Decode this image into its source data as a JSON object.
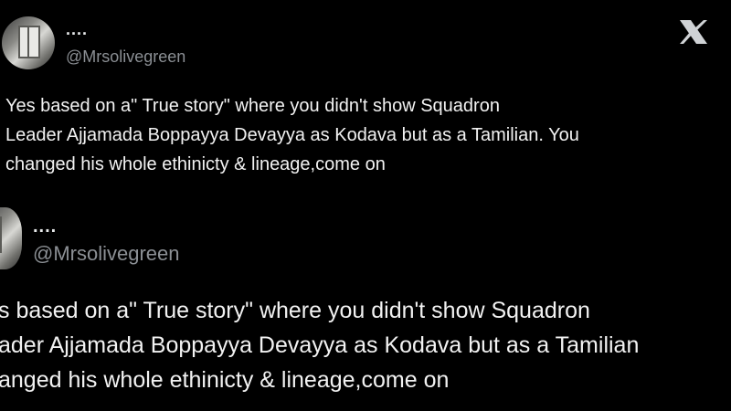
{
  "post": {
    "display_name": "....",
    "handle": "@Mrsolivegreen",
    "text_lines": [
      "Yes based on a\" True story\" where you didn't show Squadron",
      "Leader Ajjamada Boppayya Devayya as Kodava but as a Tamilian. You",
      "changed his whole ethinicty & lineage,come on"
    ],
    "logo_icon": "x-logo-icon"
  },
  "zoomed_post": {
    "display_name": "....",
    "handle": "@Mrsolivegreen",
    "text_lines": [
      "s based on a\" True story\" where you didn't show Squadron",
      "ader Ajjamada Boppayya Devayya as Kodava but as a Tamilian",
      "anged his whole ethinicty & lineage,come on"
    ]
  },
  "colors": {
    "background": "#000000",
    "text": "#f2f2f2",
    "handle": "#8b8f94"
  }
}
